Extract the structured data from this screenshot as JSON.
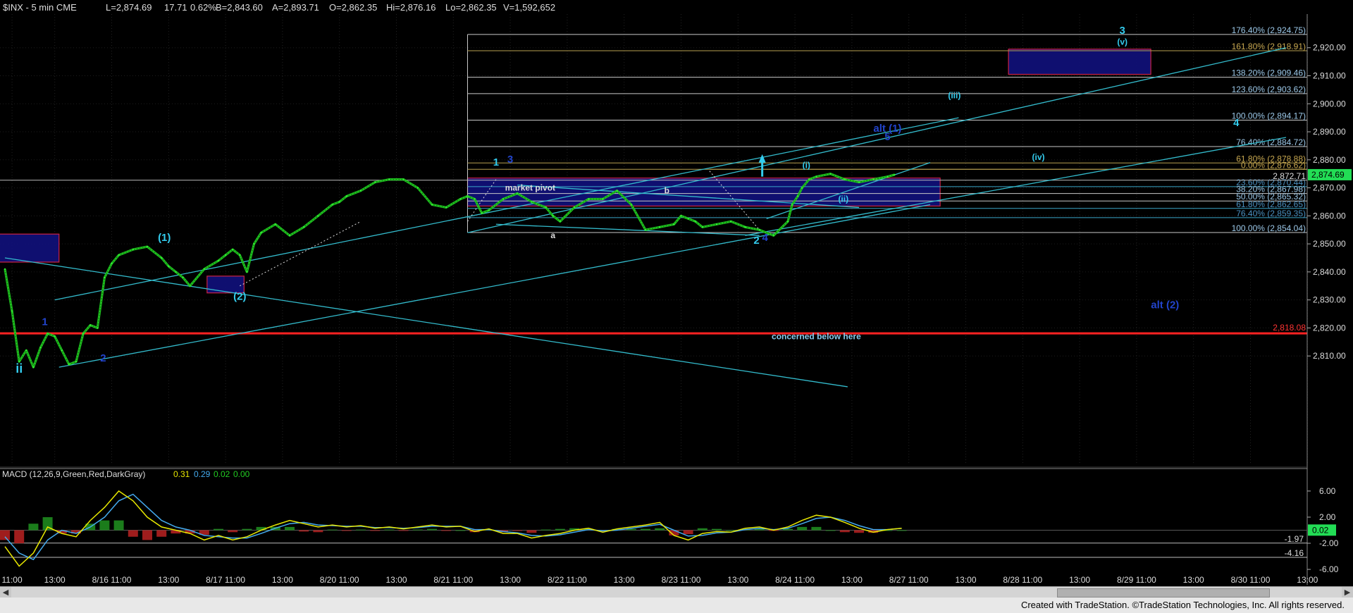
{
  "header": {
    "symbol_line": "$INX - 5 min  CME",
    "L": "L=2,874.69",
    "chg": "17.71",
    "pct": "0.62%",
    "B": "B=2,843.60",
    "A": "A=2,893.71",
    "O": "O=2,862.35",
    "Hi": "Hi=2,876.16",
    "Lo": "Lo=2,862.35",
    "V": "V=1,592,652"
  },
  "macd_header": {
    "label": "MACD (12,26,9,Green,Red,DarkGray)",
    "v1": "0.31",
    "v2": "0.29",
    "v3": "0.02",
    "v4": "0.00"
  },
  "footer_text": "Created with TradeStation. ©TradeStation Technologies, Inc. All rights reserved.",
  "colors": {
    "background": "#000000",
    "price": "#22cc22",
    "channel": "#33bbcc",
    "fib": "#c8c8c8",
    "fib_gold": "#b8a050",
    "fib_label": "#88b8d8",
    "support": "#ff2222",
    "box_fill": "#10107a",
    "box_border": "#cc2244",
    "wave_cyan": "#33ccee",
    "wave_blue": "#2244cc",
    "last_price_bg": "#22dd55",
    "macd_bg": "#22dd55"
  },
  "chart_data": {
    "type": "line",
    "title": "$INX - 5 min",
    "price_axis": {
      "ylim": [
        2801,
        2932
      ],
      "ticks": [
        "2,920.00",
        "2,910.00",
        "2,900.00",
        "2,890.00",
        "2,880.00",
        "2,870.00",
        "2,860.00",
        "2,850.00",
        "2,840.00",
        "2,830.00",
        "2,820.00",
        "2,810.00"
      ],
      "tick_values": [
        2920,
        2910,
        2900,
        2890,
        2880,
        2870,
        2860,
        2850,
        2840,
        2830,
        2820,
        2810
      ],
      "last_price_label": "2,874.69",
      "last_price": 2874.69
    },
    "macd_axis": {
      "ylim": [
        -7.5,
        7.5
      ],
      "ticks": [
        "6.00",
        "2.00",
        "-2.00",
        "-6.00"
      ],
      "tick_values": [
        6,
        2,
        -2,
        -6
      ],
      "labels": [
        {
          "text": "-1.97",
          "value": -1.97
        },
        {
          "text": "-4.16",
          "value": -4.16
        },
        {
          "text": "0.02",
          "value": 0.02
        }
      ]
    },
    "x_axis": {
      "ticks": [
        "11:00",
        "13:00",
        "8/16 11:00",
        "13:00",
        "8/17 11:00",
        "13:00",
        "8/20 11:00",
        "13:00",
        "8/21 11:00",
        "13:00",
        "8/22 11:00",
        "13:00",
        "8/23 11:00",
        "13:00",
        "8/24 11:00",
        "13:00",
        "8/27 11:00",
        "13:00",
        "8/28 11:00",
        "13:00",
        "8/29 11:00",
        "13:00",
        "8/30 11:00",
        "13:00"
      ],
      "tick_index": [
        0.5,
        3.5,
        7.5,
        11.5,
        15.5,
        19.5,
        23.5,
        27.5,
        31.5,
        35.5,
        39.5,
        43.5,
        47.5,
        51.5,
        55.5,
        59.5,
        63.5,
        67.5,
        71.5,
        75.5,
        79.5,
        83.5,
        87.5,
        91.5
      ]
    },
    "series": [
      {
        "type": "close",
        "x": [
          0,
          0.5,
          1,
          1.5,
          2,
          2.5,
          3,
          3.5,
          4,
          4.5,
          5,
          5.5,
          6,
          6.5,
          7,
          7.5,
          8,
          9,
          10,
          11,
          11.5,
          12,
          12.5,
          13,
          14,
          15,
          15.5,
          16,
          16.5,
          17,
          17.5,
          18,
          19,
          20,
          21,
          22,
          23,
          23.5,
          24,
          25,
          26,
          27,
          28,
          29,
          30,
          31,
          32,
          32.5,
          33,
          33.5,
          34,
          35,
          36,
          37,
          38,
          38.5,
          39,
          40,
          41,
          42,
          43,
          44,
          45,
          46,
          47,
          47.5,
          48,
          48.5,
          49,
          50,
          51,
          52,
          53,
          54,
          55,
          55.3,
          55.7,
          56,
          56.5,
          57,
          58,
          59,
          60,
          61,
          62,
          62.5
        ],
        "y": [
          2841,
          2826,
          2808,
          2812,
          2806,
          2813,
          2818,
          2817,
          2812,
          2807,
          2808,
          2818,
          2821,
          2820,
          2838,
          2843,
          2846,
          2848,
          2849,
          2845,
          2842,
          2840,
          2838,
          2835,
          2841,
          2844,
          2846,
          2848,
          2846,
          2840,
          2850,
          2854,
          2857,
          2853,
          2856,
          2860,
          2864,
          2865,
          2867,
          2869,
          2872,
          2873,
          2873,
          2870,
          2864,
          2863,
          2866,
          2867,
          2866,
          2861,
          2862,
          2866,
          2868,
          2865,
          2863,
          2860,
          2858,
          2863,
          2866,
          2866,
          2869,
          2864,
          2855,
          2856,
          2857,
          2860,
          2859,
          2858,
          2856,
          2857,
          2858,
          2856,
          2855,
          2853,
          2858,
          2864,
          2867,
          2870,
          2873,
          2874,
          2875,
          2873,
          2872,
          2873,
          2874,
          2874.69
        ]
      }
    ],
    "macd_series": {
      "x": [
        0,
        1,
        2,
        3,
        4,
        5,
        6,
        7,
        8,
        9,
        10,
        11,
        12,
        13,
        14,
        15,
        16,
        17,
        18,
        19,
        20,
        21,
        22,
        23,
        24,
        25,
        26,
        27,
        28,
        29,
        30,
        31,
        32,
        33,
        34,
        35,
        36,
        37,
        38,
        39,
        40,
        41,
        42,
        43,
        44,
        45,
        46,
        47,
        48,
        49,
        50,
        51,
        52,
        53,
        54,
        55,
        56,
        57,
        58,
        59,
        60,
        61,
        62,
        63
      ],
      "macd": [
        -2.5,
        -5.5,
        -3.5,
        0.5,
        -0.5,
        -1.0,
        1.5,
        3.5,
        6.0,
        4.5,
        2.0,
        0.5,
        0.0,
        -0.5,
        -1.5,
        -0.8,
        -1.5,
        -1.0,
        0.0,
        0.8,
        1.5,
        1.0,
        0.5,
        0.8,
        0.5,
        0.7,
        0.3,
        0.5,
        0.2,
        0.5,
        0.8,
        0.5,
        0.6,
        -0.2,
        0.2,
        -0.5,
        -0.5,
        -1.2,
        -0.8,
        -0.5,
        0.0,
        0.3,
        -0.3,
        0.2,
        0.5,
        0.8,
        1.2,
        -0.8,
        -1.5,
        -0.5,
        -0.2,
        -0.3,
        0.3,
        0.5,
        0.0,
        0.5,
        1.5,
        2.3,
        2.0,
        1.2,
        0.3,
        -0.3,
        0.1,
        0.3
      ],
      "signal": [
        -1.0,
        -3.5,
        -4.5,
        -1.5,
        0.0,
        -0.5,
        0.5,
        2.0,
        4.5,
        5.5,
        3.5,
        1.5,
        0.5,
        0.0,
        -0.8,
        -1.0,
        -1.2,
        -1.2,
        -0.5,
        0.3,
        1.0,
        1.2,
        0.8,
        0.7,
        0.6,
        0.6,
        0.4,
        0.4,
        0.3,
        0.4,
        0.6,
        0.6,
        0.6,
        0.1,
        0.1,
        -0.2,
        -0.4,
        -0.8,
        -0.9,
        -0.7,
        -0.3,
        0.1,
        -0.1,
        0.0,
        0.3,
        0.6,
        0.9,
        0.0,
        -0.9,
        -0.8,
        -0.4,
        -0.3,
        0.1,
        0.3,
        0.1,
        0.3,
        1.0,
        1.8,
        2.0,
        1.5,
        0.7,
        0.1,
        0.1,
        0.3
      ]
    },
    "horizontal_lines": [
      {
        "label": "2,818.08",
        "value": 2818.08,
        "style": "support"
      },
      {
        "label": "2,872.71",
        "value": 2872.71,
        "style": "gray"
      }
    ],
    "fib_levels": [
      {
        "label": "176.40% (2,924.75)",
        "value": 2924.75,
        "color": "fib"
      },
      {
        "label": "161.80% (2,918.91)",
        "value": 2918.91,
        "color": "gold"
      },
      {
        "label": "138.20% (2,909.46)",
        "value": 2909.46,
        "color": "fib"
      },
      {
        "label": "123.60% (2,903.62)",
        "value": 2903.62,
        "color": "fib"
      },
      {
        "label": "100.00% (2,894.17)",
        "value": 2894.17,
        "color": "fib"
      },
      {
        "label": "76.40% (2,884.72)",
        "value": 2884.72,
        "color": "fib"
      },
      {
        "label": "61.80% (2,878.88)",
        "value": 2878.88,
        "color": "gold"
      },
      {
        "label": "0.00% (2,876.62)",
        "value": 2876.62,
        "color": "gold"
      },
      {
        "label": "23.60% (2,870.44)",
        "value": 2870.44,
        "color": "cyan"
      },
      {
        "label": "38.20% (2,867.98)",
        "value": 2867.98,
        "color": "fib"
      },
      {
        "label": "50.00% (2,865.32)",
        "value": 2865.32,
        "color": "fib"
      },
      {
        "label": "61.80% (2,862.65)",
        "value": 2862.65,
        "color": "cyan"
      },
      {
        "label": "76.40% (2,859.35)",
        "value": 2859.35,
        "color": "cyan"
      },
      {
        "label": "100.00% (2,854.04)",
        "value": 2854.04,
        "color": "fib"
      }
    ],
    "boxes": [
      {
        "x0": -1.0,
        "x1": 3.8,
        "y0": 2843.5,
        "y1": 2853.5
      },
      {
        "x0": 14.2,
        "x1": 16.8,
        "y0": 2832.5,
        "y1": 2838.5
      },
      {
        "x0": 32.5,
        "x1": 65.7,
        "y0": 2863.5,
        "y1": 2873.5
      },
      {
        "x0": 70.5,
        "x1": 80.5,
        "y0": 2910.5,
        "y1": 2919.5
      }
    ],
    "channel_lines": [
      {
        "x0": 3.5,
        "y0": 2830,
        "x1": 67.0,
        "y1": 2895
      },
      {
        "x0": 3.8,
        "y0": 2806,
        "x1": 65.0,
        "y1": 2864
      },
      {
        "x0": 32.5,
        "y0": 2854,
        "x1": 90.0,
        "y1": 2920
      },
      {
        "x0": 52.0,
        "y0": 2853,
        "x1": 90.0,
        "y1": 2888
      },
      {
        "x0": 0.0,
        "y0": 2845,
        "x1": 59.2,
        "y1": 2799
      },
      {
        "x0": 36.0,
        "y0": 2871,
        "x1": 60.0,
        "y1": 2863
      },
      {
        "x0": 34.5,
        "y0": 2857,
        "x1": 53.0,
        "y1": 2853
      },
      {
        "x0": 53.5,
        "y0": 2859,
        "x1": 65.0,
        "y1": 2879
      }
    ],
    "annotations": [
      {
        "text": "ii",
        "x": 1.0,
        "y": 2804,
        "color": "cyan",
        "size": 18
      },
      {
        "text": "1",
        "x": 2.8,
        "y": 2821,
        "color": "blue",
        "size": 15
      },
      {
        "text": "2",
        "x": 6.9,
        "y": 2808,
        "color": "blue",
        "size": 15
      },
      {
        "text": "(1)",
        "x": 11.2,
        "y": 2851,
        "color": "cyan",
        "size": 15
      },
      {
        "text": "(2)",
        "x": 16.5,
        "y": 2830,
        "color": "cyan",
        "size": 15
      },
      {
        "text": "1",
        "x": 34.5,
        "y": 2878,
        "color": "cyan",
        "size": 15
      },
      {
        "text": "3",
        "x": 35.5,
        "y": 2879,
        "color": "blue",
        "size": 15
      },
      {
        "text": "market pivot",
        "x": 36.9,
        "y": 2869,
        "color": "white",
        "size": 12
      },
      {
        "text": "a",
        "x": 38.5,
        "y": 2852,
        "color": "white",
        "size": 12
      },
      {
        "text": "b",
        "x": 46.5,
        "y": 2868,
        "color": "white",
        "size": 12
      },
      {
        "text": "2",
        "x": 52.8,
        "y": 2850,
        "color": "cyan",
        "size": 15
      },
      {
        "text": "4",
        "x": 53.4,
        "y": 2851,
        "color": "blue",
        "size": 15
      },
      {
        "text": "(i)",
        "x": 56.3,
        "y": 2877,
        "color": "cyan",
        "size": 12
      },
      {
        "text": "(ii)",
        "x": 58.9,
        "y": 2865,
        "color": "cyan",
        "size": 12
      },
      {
        "text": "alt (1)",
        "x": 62.0,
        "y": 2890,
        "color": "blue",
        "size": 15
      },
      {
        "text": "5",
        "x": 62.0,
        "y": 2887,
        "color": "blue",
        "size": 15
      },
      {
        "text": "(iii)",
        "x": 66.7,
        "y": 2902,
        "color": "cyan",
        "size": 12
      },
      {
        "text": "(iv)",
        "x": 72.6,
        "y": 2880,
        "color": "cyan",
        "size": 12
      },
      {
        "text": "3",
        "x": 78.5,
        "y": 2925,
        "color": "cyan",
        "size": 15
      },
      {
        "text": "(v)",
        "x": 78.5,
        "y": 2921,
        "color": "cyan",
        "size": 12
      },
      {
        "text": "4",
        "x": 86.5,
        "y": 2892,
        "color": "cyan",
        "size": 15
      },
      {
        "text": "alt (2)",
        "x": 81.5,
        "y": 2827,
        "color": "blue",
        "size": 15
      },
      {
        "text": "concerned below here",
        "x": 57.0,
        "y": 2816,
        "color": "cyan",
        "size": 12
      }
    ]
  }
}
